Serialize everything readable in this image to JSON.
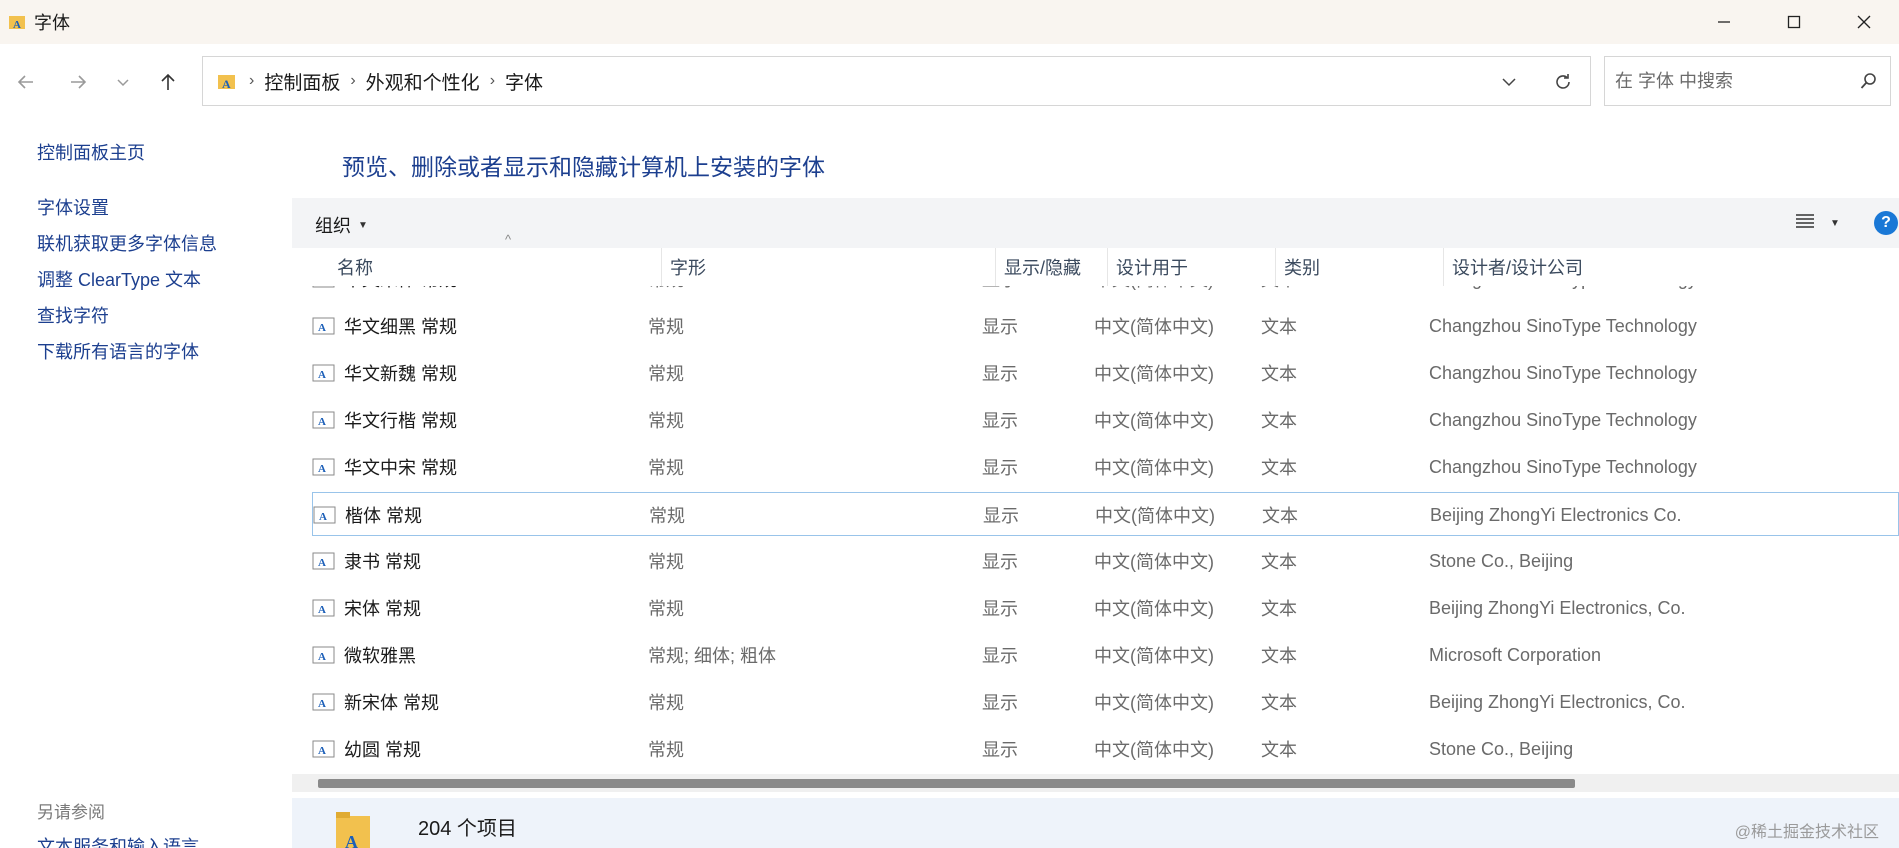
{
  "window": {
    "title": "字体",
    "icon": "font-folder-icon",
    "buttons": [
      "minimize",
      "maximize",
      "close"
    ]
  },
  "nav": {
    "back": "back-arrow-icon",
    "forward": "forward-arrow-icon",
    "recent": "chevron-down-icon",
    "up": "up-arrow-icon"
  },
  "address": {
    "crumbs": [
      "控制面板",
      "外观和个性化",
      "字体"
    ],
    "separator": "›"
  },
  "search": {
    "placeholder": "在 字体 中搜索"
  },
  "sidebar": {
    "home": "控制面板主页",
    "links": [
      "字体设置",
      "联机获取更多字体信息",
      "调整 ClearType 文本",
      "查找字符",
      "下载所有语言的字体"
    ],
    "see_also": "另请参阅",
    "see_also_link": "文本服务和输入语言"
  },
  "main": {
    "heading": "预览、删除或者显示和隐藏计算机上安装的字体"
  },
  "toolbar": {
    "organize": "组织",
    "view_icon": "details-view-icon",
    "help": "?"
  },
  "columns": [
    "名称",
    "字形",
    "显示/隐藏",
    "设计用于",
    "类别",
    "设计者/设计公司"
  ],
  "rows": [
    {
      "name": "华文宋体 常规",
      "style": "常规",
      "show": "显示",
      "design": "中文(简体中文)",
      "category": "文本",
      "maker": "Changzhou SinoType Technology"
    },
    {
      "name": "华文细黑 常规",
      "style": "常规",
      "show": "显示",
      "design": "中文(简体中文)",
      "category": "文本",
      "maker": "Changzhou SinoType Technology"
    },
    {
      "name": "华文新魏 常规",
      "style": "常规",
      "show": "显示",
      "design": "中文(简体中文)",
      "category": "文本",
      "maker": "Changzhou SinoType Technology"
    },
    {
      "name": "华文行楷 常规",
      "style": "常规",
      "show": "显示",
      "design": "中文(简体中文)",
      "category": "文本",
      "maker": "Changzhou SinoType Technology"
    },
    {
      "name": "华文中宋 常规",
      "style": "常规",
      "show": "显示",
      "design": "中文(简体中文)",
      "category": "文本",
      "maker": "Changzhou SinoType Technology"
    },
    {
      "name": "楷体 常规",
      "style": "常规",
      "show": "显示",
      "design": "中文(简体中文)",
      "category": "文本",
      "maker": "Beijing ZhongYi Electronics Co."
    },
    {
      "name": "隶书 常规",
      "style": "常规",
      "show": "显示",
      "design": "中文(简体中文)",
      "category": "文本",
      "maker": "Stone Co., Beijing"
    },
    {
      "name": "宋体 常规",
      "style": "常规",
      "show": "显示",
      "design": "中文(简体中文)",
      "category": "文本",
      "maker": "Beijing ZhongYi Electronics, Co."
    },
    {
      "name": "微软雅黑",
      "style": "常规; 细体; 粗体",
      "show": "显示",
      "design": "中文(简体中文)",
      "category": "文本",
      "maker": "Microsoft Corporation"
    },
    {
      "name": "新宋体 常规",
      "style": "常规",
      "show": "显示",
      "design": "中文(简体中文)",
      "category": "文本",
      "maker": "Beijing ZhongYi Electronics, Co."
    },
    {
      "name": "幼圆 常规",
      "style": "常规",
      "show": "显示",
      "design": "中文(简体中文)",
      "category": "文本",
      "maker": "Stone Co., Beijing"
    }
  ],
  "selected_row": 5,
  "status": {
    "count": "204 个项目"
  },
  "watermark": "@稀土掘金技术社区",
  "colors": {
    "link": "#1c3f8f",
    "title_bg": "#f9f5f0",
    "toolbar_bg": "#f3f4f6",
    "selection_border": "#99c4ea",
    "help_blue": "#1a78d6"
  }
}
